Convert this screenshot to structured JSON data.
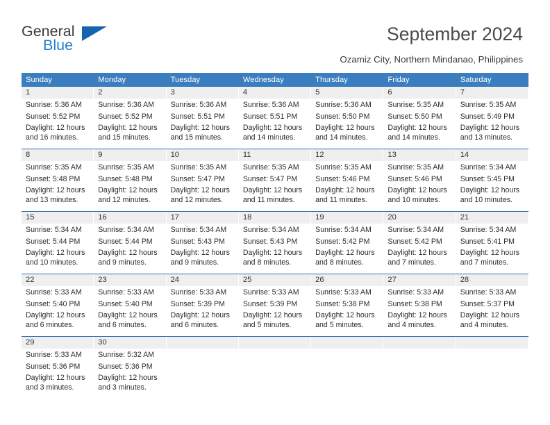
{
  "brand": {
    "name_primary": "General",
    "name_secondary": "Blue",
    "logo_icon": "triangle-logo-icon"
  },
  "header": {
    "title": "September 2024",
    "subtitle": "Ozamiz City, Northern Mindanao, Philippines",
    "accent_color": "#3b7ebf",
    "rule_color": "#2f6fb0",
    "daynum_band_color": "#efefef"
  },
  "weekdays": [
    "Sunday",
    "Monday",
    "Tuesday",
    "Wednesday",
    "Thursday",
    "Friday",
    "Saturday"
  ],
  "weeks": [
    {
      "cells": [
        {
          "day": "1",
          "sunrise": "Sunrise: 5:36 AM",
          "sunset": "Sunset: 5:52 PM",
          "daylight": "Daylight: 12 hours and 16 minutes."
        },
        {
          "day": "2",
          "sunrise": "Sunrise: 5:36 AM",
          "sunset": "Sunset: 5:52 PM",
          "daylight": "Daylight: 12 hours and 15 minutes."
        },
        {
          "day": "3",
          "sunrise": "Sunrise: 5:36 AM",
          "sunset": "Sunset: 5:51 PM",
          "daylight": "Daylight: 12 hours and 15 minutes."
        },
        {
          "day": "4",
          "sunrise": "Sunrise: 5:36 AM",
          "sunset": "Sunset: 5:51 PM",
          "daylight": "Daylight: 12 hours and 14 minutes."
        },
        {
          "day": "5",
          "sunrise": "Sunrise: 5:36 AM",
          "sunset": "Sunset: 5:50 PM",
          "daylight": "Daylight: 12 hours and 14 minutes."
        },
        {
          "day": "6",
          "sunrise": "Sunrise: 5:35 AM",
          "sunset": "Sunset: 5:50 PM",
          "daylight": "Daylight: 12 hours and 14 minutes."
        },
        {
          "day": "7",
          "sunrise": "Sunrise: 5:35 AM",
          "sunset": "Sunset: 5:49 PM",
          "daylight": "Daylight: 12 hours and 13 minutes."
        }
      ]
    },
    {
      "cells": [
        {
          "day": "8",
          "sunrise": "Sunrise: 5:35 AM",
          "sunset": "Sunset: 5:48 PM",
          "daylight": "Daylight: 12 hours and 13 minutes."
        },
        {
          "day": "9",
          "sunrise": "Sunrise: 5:35 AM",
          "sunset": "Sunset: 5:48 PM",
          "daylight": "Daylight: 12 hours and 12 minutes."
        },
        {
          "day": "10",
          "sunrise": "Sunrise: 5:35 AM",
          "sunset": "Sunset: 5:47 PM",
          "daylight": "Daylight: 12 hours and 12 minutes."
        },
        {
          "day": "11",
          "sunrise": "Sunrise: 5:35 AM",
          "sunset": "Sunset: 5:47 PM",
          "daylight": "Daylight: 12 hours and 11 minutes."
        },
        {
          "day": "12",
          "sunrise": "Sunrise: 5:35 AM",
          "sunset": "Sunset: 5:46 PM",
          "daylight": "Daylight: 12 hours and 11 minutes."
        },
        {
          "day": "13",
          "sunrise": "Sunrise: 5:35 AM",
          "sunset": "Sunset: 5:46 PM",
          "daylight": "Daylight: 12 hours and 10 minutes."
        },
        {
          "day": "14",
          "sunrise": "Sunrise: 5:34 AM",
          "sunset": "Sunset: 5:45 PM",
          "daylight": "Daylight: 12 hours and 10 minutes."
        }
      ]
    },
    {
      "cells": [
        {
          "day": "15",
          "sunrise": "Sunrise: 5:34 AM",
          "sunset": "Sunset: 5:44 PM",
          "daylight": "Daylight: 12 hours and 10 minutes."
        },
        {
          "day": "16",
          "sunrise": "Sunrise: 5:34 AM",
          "sunset": "Sunset: 5:44 PM",
          "daylight": "Daylight: 12 hours and 9 minutes."
        },
        {
          "day": "17",
          "sunrise": "Sunrise: 5:34 AM",
          "sunset": "Sunset: 5:43 PM",
          "daylight": "Daylight: 12 hours and 9 minutes."
        },
        {
          "day": "18",
          "sunrise": "Sunrise: 5:34 AM",
          "sunset": "Sunset: 5:43 PM",
          "daylight": "Daylight: 12 hours and 8 minutes."
        },
        {
          "day": "19",
          "sunrise": "Sunrise: 5:34 AM",
          "sunset": "Sunset: 5:42 PM",
          "daylight": "Daylight: 12 hours and 8 minutes."
        },
        {
          "day": "20",
          "sunrise": "Sunrise: 5:34 AM",
          "sunset": "Sunset: 5:42 PM",
          "daylight": "Daylight: 12 hours and 7 minutes."
        },
        {
          "day": "21",
          "sunrise": "Sunrise: 5:34 AM",
          "sunset": "Sunset: 5:41 PM",
          "daylight": "Daylight: 12 hours and 7 minutes."
        }
      ]
    },
    {
      "cells": [
        {
          "day": "22",
          "sunrise": "Sunrise: 5:33 AM",
          "sunset": "Sunset: 5:40 PM",
          "daylight": "Daylight: 12 hours and 6 minutes."
        },
        {
          "day": "23",
          "sunrise": "Sunrise: 5:33 AM",
          "sunset": "Sunset: 5:40 PM",
          "daylight": "Daylight: 12 hours and 6 minutes."
        },
        {
          "day": "24",
          "sunrise": "Sunrise: 5:33 AM",
          "sunset": "Sunset: 5:39 PM",
          "daylight": "Daylight: 12 hours and 6 minutes."
        },
        {
          "day": "25",
          "sunrise": "Sunrise: 5:33 AM",
          "sunset": "Sunset: 5:39 PM",
          "daylight": "Daylight: 12 hours and 5 minutes."
        },
        {
          "day": "26",
          "sunrise": "Sunrise: 5:33 AM",
          "sunset": "Sunset: 5:38 PM",
          "daylight": "Daylight: 12 hours and 5 minutes."
        },
        {
          "day": "27",
          "sunrise": "Sunrise: 5:33 AM",
          "sunset": "Sunset: 5:38 PM",
          "daylight": "Daylight: 12 hours and 4 minutes."
        },
        {
          "day": "28",
          "sunrise": "Sunrise: 5:33 AM",
          "sunset": "Sunset: 5:37 PM",
          "daylight": "Daylight: 12 hours and 4 minutes."
        }
      ]
    },
    {
      "cells": [
        {
          "day": "29",
          "sunrise": "Sunrise: 5:33 AM",
          "sunset": "Sunset: 5:36 PM",
          "daylight": "Daylight: 12 hours and 3 minutes."
        },
        {
          "day": "30",
          "sunrise": "Sunrise: 5:32 AM",
          "sunset": "Sunset: 5:36 PM",
          "daylight": "Daylight: 12 hours and 3 minutes."
        },
        {
          "day": "",
          "sunrise": "",
          "sunset": "",
          "daylight": ""
        },
        {
          "day": "",
          "sunrise": "",
          "sunset": "",
          "daylight": ""
        },
        {
          "day": "",
          "sunrise": "",
          "sunset": "",
          "daylight": ""
        },
        {
          "day": "",
          "sunrise": "",
          "sunset": "",
          "daylight": ""
        },
        {
          "day": "",
          "sunrise": "",
          "sunset": "",
          "daylight": ""
        }
      ]
    }
  ]
}
